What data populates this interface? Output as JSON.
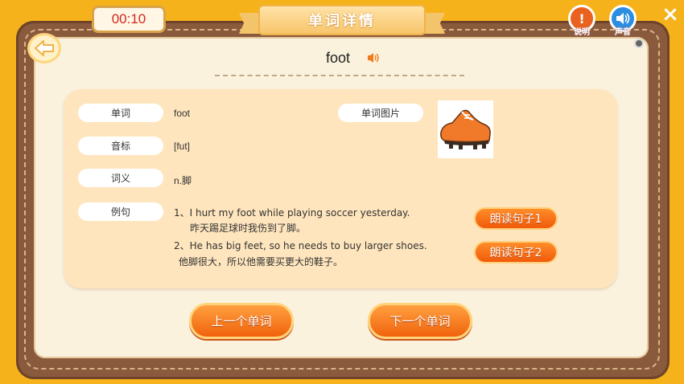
{
  "timer": "00:10",
  "title": "单词详情",
  "top_buttons": {
    "help_glyph": "!",
    "help_caption": "说明",
    "sound_caption": "声音"
  },
  "icons": {
    "back": "back-arrow-icon",
    "speaker": "speaker-icon",
    "help": "help-icon",
    "sound": "sound-icon",
    "close": "close-icon",
    "image": "shoe-image"
  },
  "close_glyph": "×",
  "word": "foot",
  "labels": {
    "word": "单词",
    "phonetic": "音标",
    "meaning": "词义",
    "example": "例句",
    "picture": "单词图片"
  },
  "values": {
    "word": "foot",
    "phonetic": "[fut]",
    "meaning": "n.脚"
  },
  "examples": [
    {
      "en": "1、I hurt my foot while playing soccer yesterday.",
      "zh": "昨天踢足球时我伤到了脚。"
    },
    {
      "en": "2、He has big feet, so he needs to buy larger shoes.",
      "zh": "他脚很大，所以他需要买更大的鞋子。"
    }
  ],
  "read_buttons": [
    "朗读句子1",
    "朗读句子2"
  ],
  "nav": {
    "prev": "上一个单词",
    "next": "下一个单词"
  },
  "colors": {
    "background": "#f6b21a",
    "board": "#8a5a3c",
    "paper": "#fbf2de",
    "card": "#ffe5bd",
    "button": "#f06a12",
    "timer_text": "#d4281c"
  }
}
